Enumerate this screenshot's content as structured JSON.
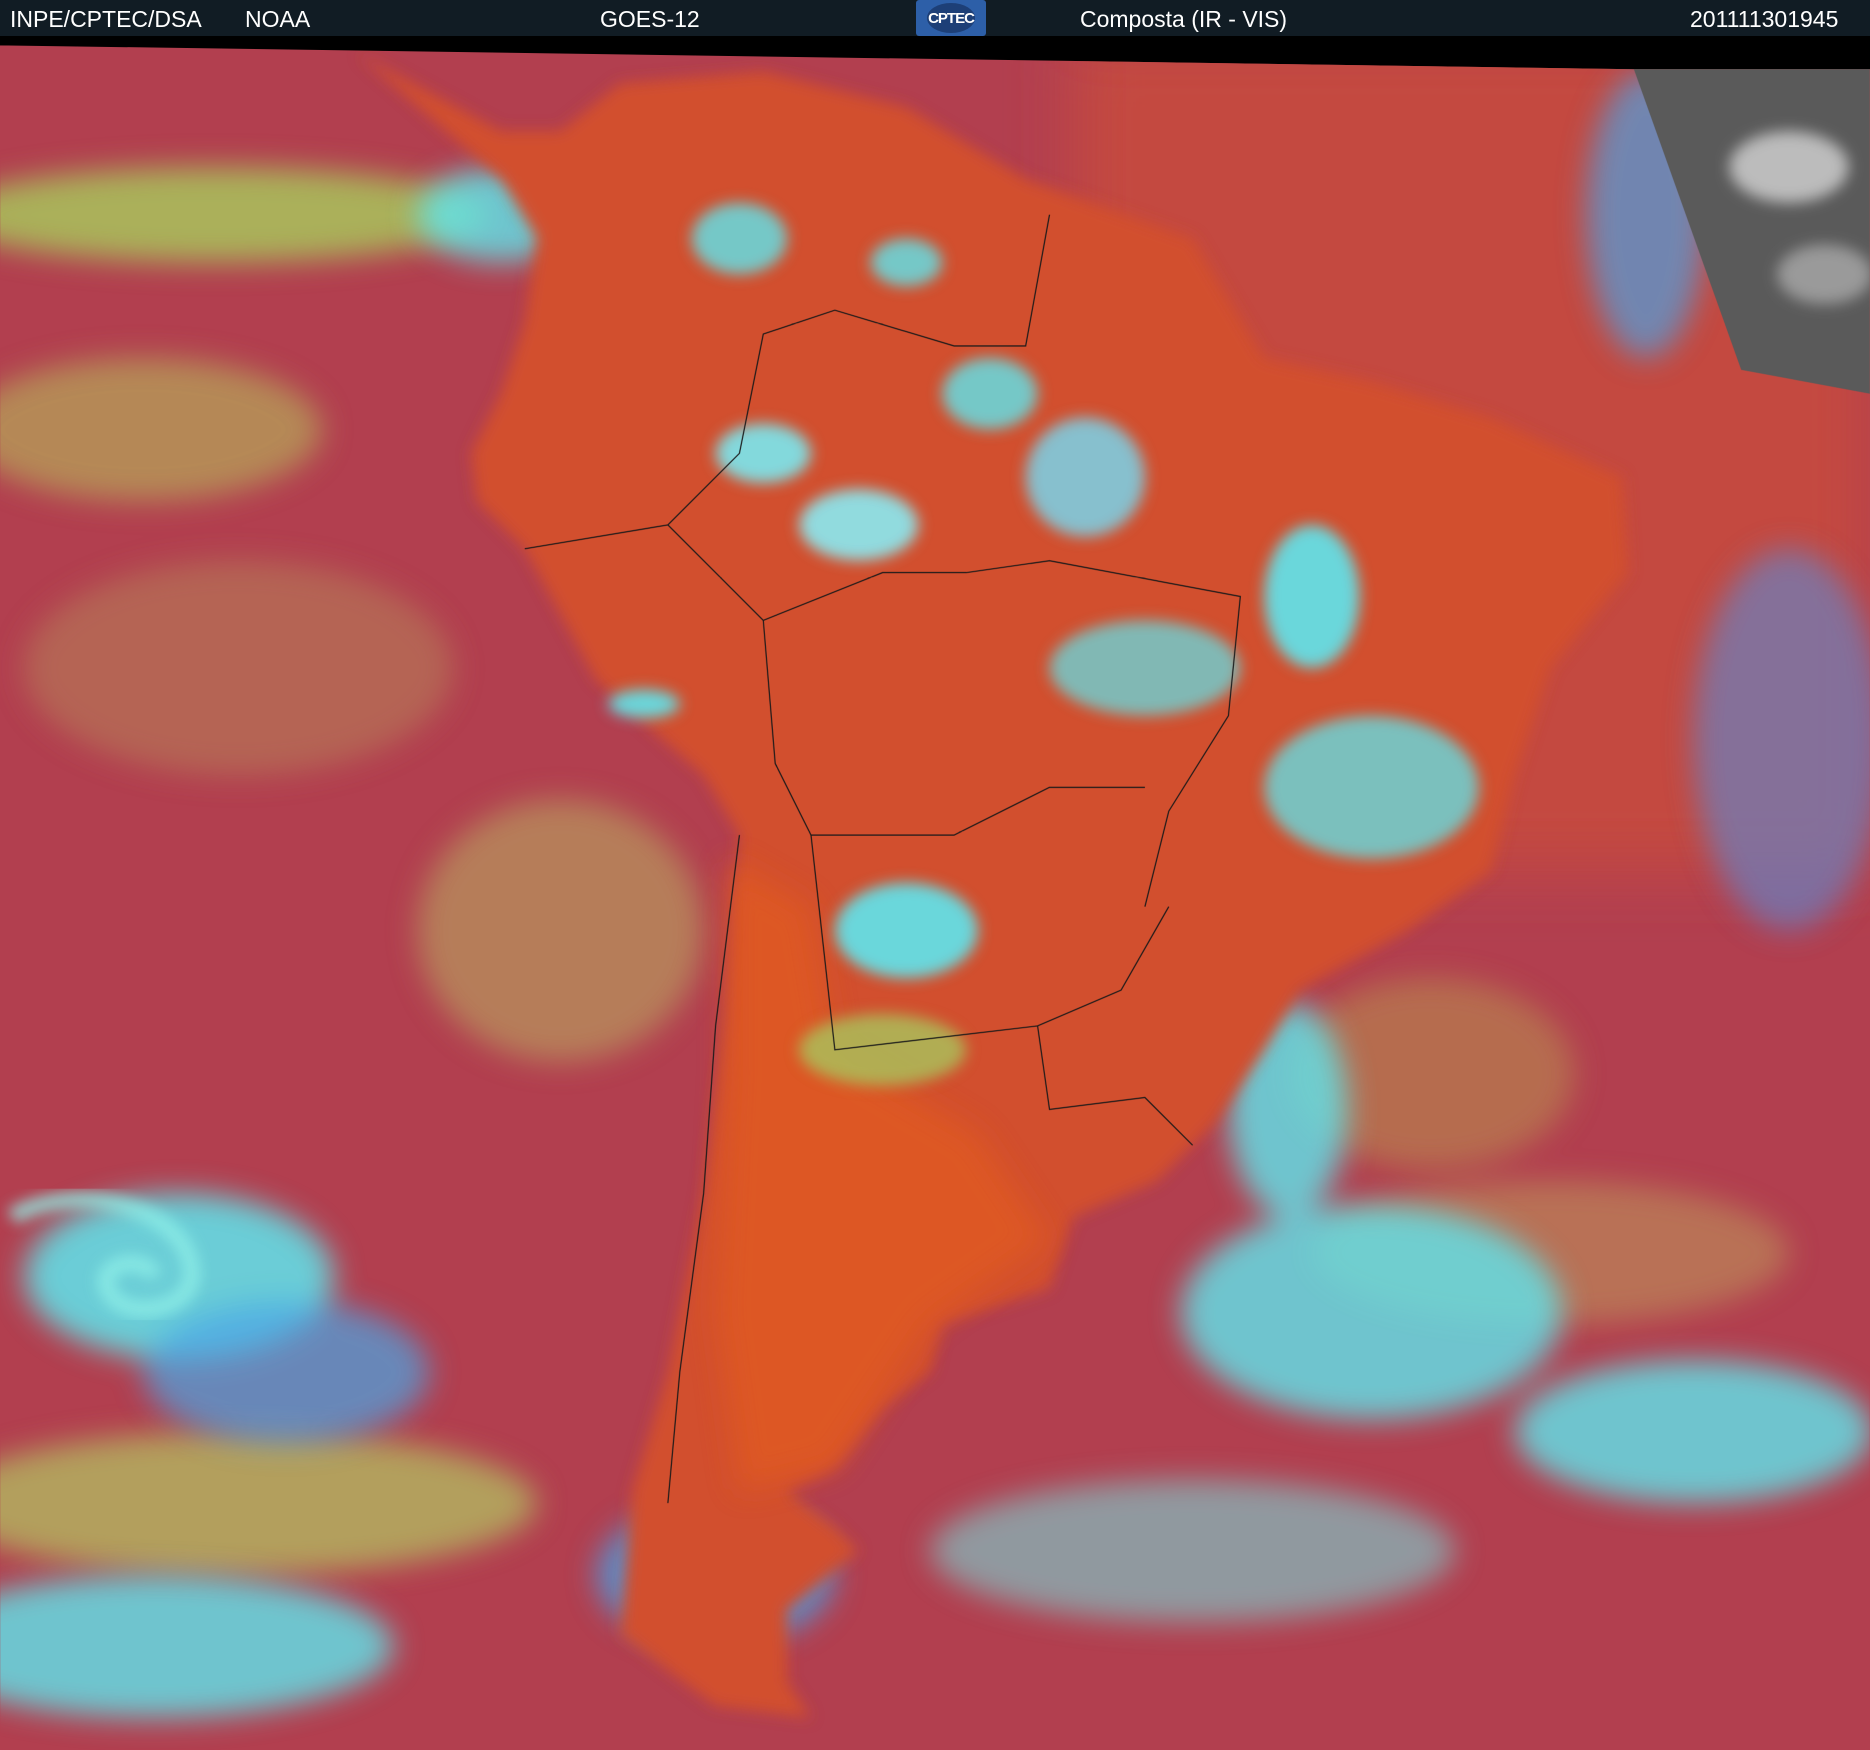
{
  "header": {
    "source": "INPE/CPTEC/DSA",
    "agency": "NOAA",
    "satellite": "GOES-12",
    "logo_text": "CPTEC",
    "product": "Composta (IR - VIS)",
    "timestamp": "201111301945"
  },
  "colors": {
    "header_bg": "#111c24",
    "ocean_clear": "#b23f4f",
    "land_clear": "#d2502e",
    "low_cloud": "#a9c45c",
    "high_cloud": "#5ee6ee",
    "border_lines": "#1a1a1a"
  }
}
